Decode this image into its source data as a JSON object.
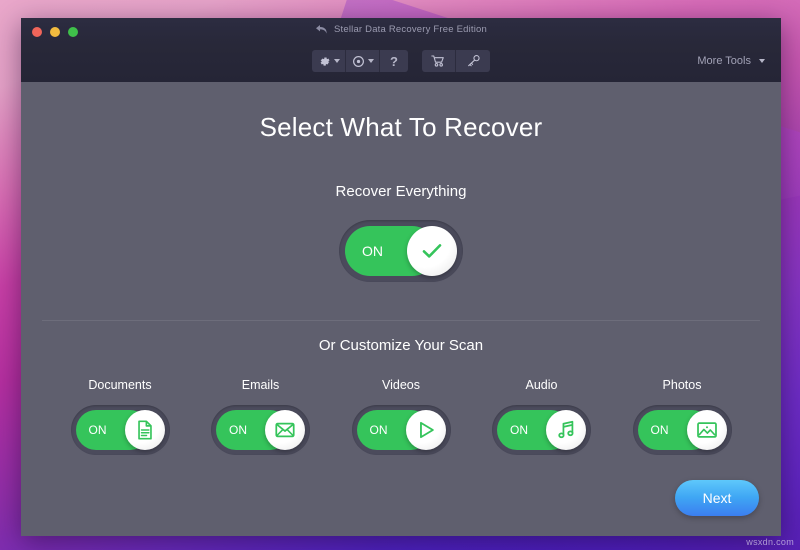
{
  "window": {
    "title": "Stellar Data Recovery Free Edition",
    "traffic_lights": {
      "close": "close-button",
      "minimize": "minimize-button",
      "zoom": "zoom-button"
    }
  },
  "toolbar": {
    "settings_icon": "gear-icon",
    "settings_caret": "chevron-down-icon",
    "recover_icon": "target-icon",
    "recover_caret": "chevron-down-icon",
    "help_label": "?",
    "cart_icon": "shopping-cart-icon",
    "key_icon": "key-icon",
    "more_tools_label": "More Tools",
    "more_tools_caret": "chevron-down-icon"
  },
  "main": {
    "page_title": "Select What To Recover",
    "recover_everything": {
      "label": "Recover Everything",
      "toggle_state": "ON",
      "icon": "check-icon"
    },
    "customize_title": "Or Customize Your Scan",
    "categories": [
      {
        "label": "Documents",
        "toggle_state": "ON",
        "icon": "document-icon"
      },
      {
        "label": "Emails",
        "toggle_state": "ON",
        "icon": "envelope-icon"
      },
      {
        "label": "Videos",
        "toggle_state": "ON",
        "icon": "play-icon"
      },
      {
        "label": "Audio",
        "toggle_state": "ON",
        "icon": "music-note-icon"
      },
      {
        "label": "Photos",
        "toggle_state": "ON",
        "icon": "image-icon"
      }
    ],
    "next_label": "Next"
  },
  "watermark": "wsxdn.com",
  "colors": {
    "accent_green": "#35c45b",
    "next_blue": "#3fa6f4",
    "window_bg": "#5f5f6e",
    "titlebar_bg": "#2a2a3d",
    "track": "#4b4b5c"
  }
}
